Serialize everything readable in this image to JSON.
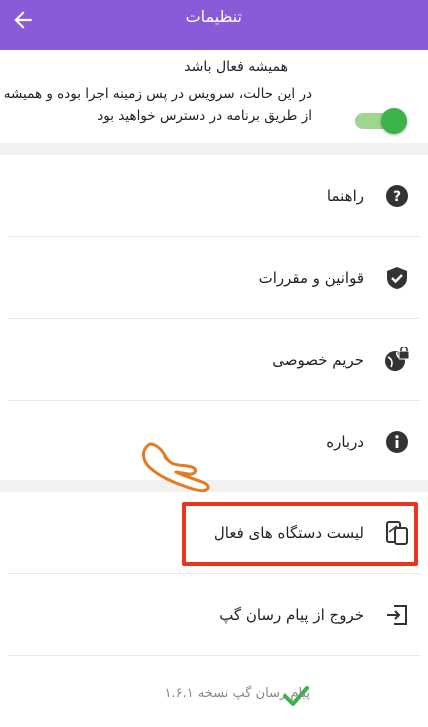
{
  "header": {
    "title": "تنظیمات",
    "back_icon": "arrow-left-icon",
    "color": "#8a5bd9"
  },
  "always_on": {
    "title": "همیشه فعال باشد",
    "description": "در این حالت، سرویس در پس زمینه اجرا بوده و همیشه از طریق برنامه در دسترس خواهید بود",
    "enabled": true,
    "accent": "#3db24a"
  },
  "menu": [
    {
      "label": "راهنما",
      "icon": "help-circle-icon"
    },
    {
      "label": "قوانین و مقررات",
      "icon": "shield-check-icon"
    },
    {
      "label": "حریم خصوصی",
      "icon": "globe-lock-icon"
    },
    {
      "label": "درباره",
      "icon": "info-icon"
    }
  ],
  "menu2": [
    {
      "label": "لیست دستگاه های فعال",
      "icon": "devices-icon"
    },
    {
      "label": "خروج از پیام رسان گپ",
      "icon": "exit-icon"
    }
  ],
  "footer": {
    "version_text": "پیام رسان گپ نسخه ۱.۶.۱",
    "check_icon": "check-icon",
    "check_color": "#3db24a"
  },
  "annotation": {
    "highlight_color": "#e8361a",
    "pointer_icon": "hand-pointer-icon"
  }
}
